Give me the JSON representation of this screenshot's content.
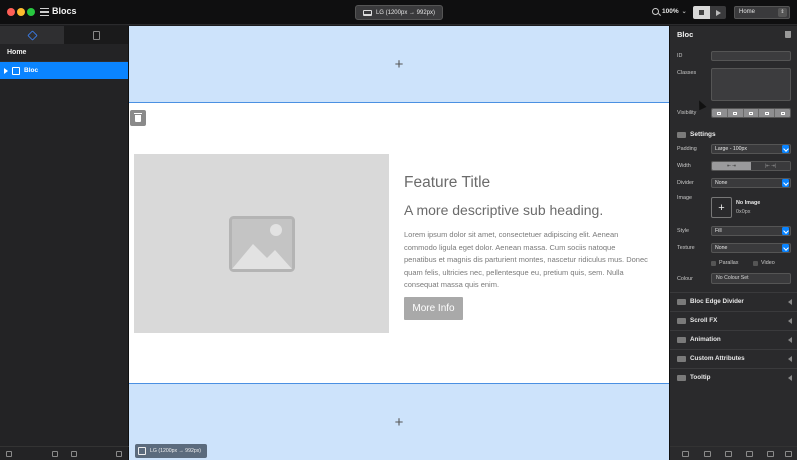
{
  "app": {
    "title": "Blocs",
    "device_label": "LG (1200px → 992px)",
    "zoom": "100%",
    "page_select": "Home",
    "colors": {
      "accent": "#0a84ff",
      "dropzone": "#cde3fb",
      "dropzone_line": "#4a90e2"
    }
  },
  "left_panel": {
    "tabs": [
      {
        "name": "layers",
        "icon": "layers-icon"
      },
      {
        "name": "pages",
        "icon": "page-icon"
      }
    ],
    "page": "Home",
    "tree": [
      {
        "label": "Bloc",
        "icon": "bloc-icon",
        "selected": true
      }
    ]
  },
  "canvas": {
    "add_symbol": "+",
    "feature_title": "Feature Title",
    "sub_heading": "A more descriptive sub heading.",
    "body_text": "Lorem ipsum dolor sit amet, consectetuer adipiscing elit. Aenean commodo ligula eget dolor. Aenean massa. Cum sociis natoque penatibus et magnis dis parturient montes, nascetur ridiculus mus. Donec quam felis, ultricies nec, pellentesque eu, pretium quis, sem. Nulla consequat massa quis enim.",
    "button_label": "More Info",
    "breakpoint_label": "LG (1200px → 992px)"
  },
  "right_panel": {
    "title": "Bloc",
    "labels": {
      "id": "ID",
      "classes": "Classes",
      "visibility": "Visibility",
      "settings": "Settings",
      "padding": "Padding",
      "width": "Width",
      "divider": "Divider",
      "image": "Image",
      "style": "Style",
      "texture": "Texture",
      "colour": "Colour"
    },
    "padding_value": "Large - 100px",
    "divider_value": "None",
    "image_name": "No Image",
    "image_size": "0x0px",
    "style_value": "Fill",
    "texture_value": "None",
    "parallax_label": "Parallax",
    "video_label": "Video",
    "colour_value": "No Colour Set",
    "add_image_symbol": "+",
    "width_fixed": "⇤ ⇥",
    "width_full": "|⇤ ⇥|",
    "sections": [
      "Bloc Edge Divider",
      "Scroll FX",
      "Animation",
      "Custom Attributes",
      "Tooltip"
    ]
  }
}
